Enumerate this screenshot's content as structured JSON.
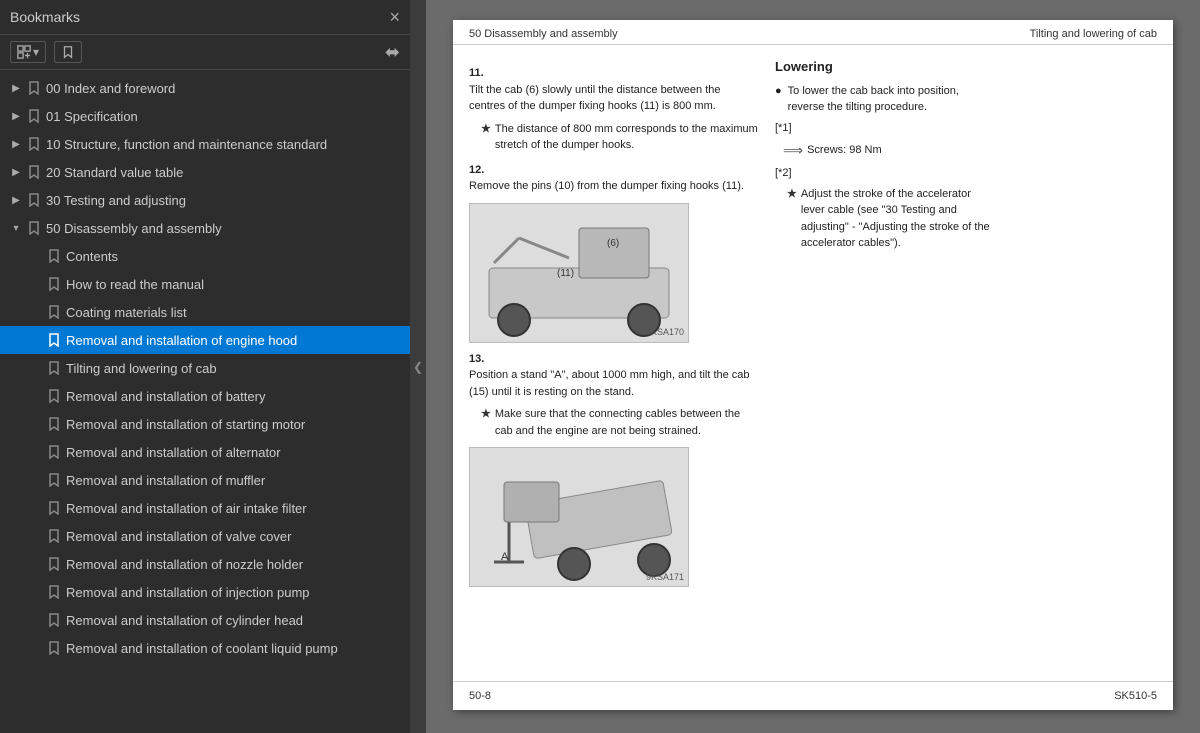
{
  "sidebar": {
    "title": "Bookmarks",
    "close_label": "×",
    "toolbar": {
      "expand_label": "⊞",
      "bookmark_label": "🔖"
    },
    "items": [
      {
        "id": "idx",
        "level": 0,
        "label": "00 Index and foreword",
        "expanded": false,
        "hasChildren": true
      },
      {
        "id": "spec",
        "level": 0,
        "label": "01 Specification",
        "expanded": false,
        "hasChildren": true
      },
      {
        "id": "struct",
        "level": 0,
        "label": "10 Structure, function and maintenance standard",
        "expanded": false,
        "hasChildren": true
      },
      {
        "id": "std",
        "level": 0,
        "label": "20 Standard value table",
        "expanded": false,
        "hasChildren": true
      },
      {
        "id": "test",
        "level": 0,
        "label": "30 Testing and adjusting",
        "expanded": false,
        "hasChildren": true
      },
      {
        "id": "dis",
        "level": 0,
        "label": "50 Disassembly and assembly",
        "expanded": true,
        "hasChildren": true
      },
      {
        "id": "contents",
        "level": 1,
        "label": "Contents",
        "expanded": false,
        "hasChildren": false
      },
      {
        "id": "howto",
        "level": 1,
        "label": "How to read the manual",
        "expanded": false,
        "hasChildren": false
      },
      {
        "id": "coating",
        "level": 1,
        "label": "Coating materials list",
        "expanded": false,
        "hasChildren": false
      },
      {
        "id": "enghood",
        "level": 1,
        "label": "Removal and installation of engine hood",
        "expanded": false,
        "hasChildren": false,
        "selected": true
      },
      {
        "id": "cab",
        "level": 1,
        "label": "Tilting and lowering of cab",
        "expanded": false,
        "hasChildren": false
      },
      {
        "id": "battery",
        "level": 1,
        "label": "Removal and installation of battery",
        "expanded": false,
        "hasChildren": false
      },
      {
        "id": "startmotor",
        "level": 1,
        "label": "Removal and installation of starting motor",
        "expanded": false,
        "hasChildren": false
      },
      {
        "id": "alternator",
        "level": 1,
        "label": "Removal and installation of alternator",
        "expanded": false,
        "hasChildren": false
      },
      {
        "id": "muffler",
        "level": 1,
        "label": "Removal and installation of muffler",
        "expanded": false,
        "hasChildren": false
      },
      {
        "id": "airintake",
        "level": 1,
        "label": "Removal and installation of air intake filter",
        "expanded": false,
        "hasChildren": false
      },
      {
        "id": "valvecover",
        "level": 1,
        "label": "Removal and installation of valve cover",
        "expanded": false,
        "hasChildren": false
      },
      {
        "id": "nozzle",
        "level": 1,
        "label": "Removal and installation of nozzle holder",
        "expanded": false,
        "hasChildren": false
      },
      {
        "id": "injection",
        "level": 1,
        "label": "Removal and installation of injection pump",
        "expanded": false,
        "hasChildren": false
      },
      {
        "id": "cylinder",
        "level": 1,
        "label": "Removal and installation of cylinder head",
        "expanded": false,
        "hasChildren": false
      },
      {
        "id": "coolant",
        "level": 1,
        "label": "Removal and installation of coolant liquid pump",
        "expanded": false,
        "hasChildren": false
      }
    ]
  },
  "page": {
    "header_left": "50 Disassembly and assembly",
    "header_right": "Tilting and lowering of cab",
    "step11_num": "11.",
    "step11_text": "Tilt the cab (6) slowly until the distance between the centres of the dumper fixing hooks (11) is 800 mm.",
    "step11_note": "The distance of 800 mm corresponds to the maximum stretch of the dumper hooks.",
    "step12_num": "12.",
    "step12_text": "Remove the pins (10) from the dumper fixing hooks (11).",
    "step13_num": "13.",
    "step13_text": "Position a stand \"A\", about 1000 mm high, and tilt the cab (15) until it is resting on the stand.",
    "step13_note": "Make sure that the connecting cables between the cab and the engine are not being strained.",
    "diagram1_label": "9KSA170",
    "diagram2_label": "9KSA171",
    "lowering_title": "Lowering",
    "lowering_bullet": "To lower the cab back into position, reverse the tilting procedure.",
    "ref1": "[*1]",
    "screws_label": "Screws: 98 Nm",
    "ref2": "[*2]",
    "ref2_note": "Adjust the stroke of the accelerator lever cable (see \"30 Testing and adjusting\" - \"Adjusting the stroke of the accelerator cables\").",
    "footer_left": "50-8",
    "footer_right": "SK510-5"
  }
}
